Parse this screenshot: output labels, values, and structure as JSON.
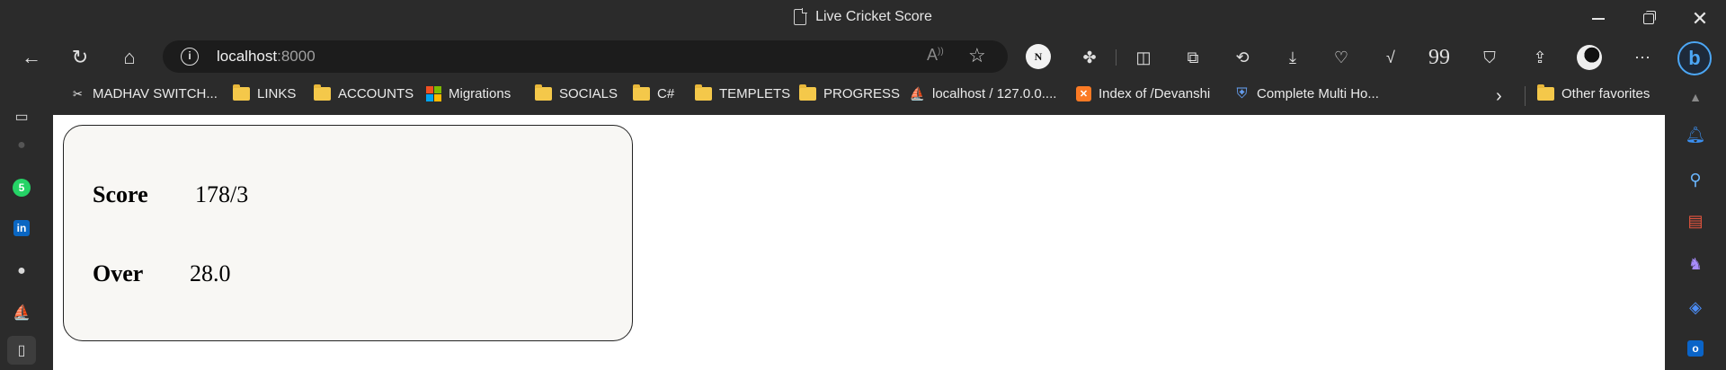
{
  "window": {
    "title": "Live Cricket Score"
  },
  "address_bar": {
    "host": "localhost",
    "port": ":8000"
  },
  "profile": {
    "extension_badge": "N"
  },
  "favorites": [
    {
      "label": "MADHAV SWITCH...",
      "icon": "scissors-icon"
    },
    {
      "label": "LINKS",
      "icon": "folder-icon"
    },
    {
      "label": "ACCOUNTS",
      "icon": "folder-icon"
    },
    {
      "label": "Migrations",
      "icon": "microsoft-logo-icon"
    },
    {
      "label": "SOCIALS",
      "icon": "folder-icon"
    },
    {
      "label": "C#",
      "icon": "folder-icon"
    },
    {
      "label": "TEMPLETS",
      "icon": "folder-icon"
    },
    {
      "label": "PROGRESS",
      "icon": "folder-icon"
    },
    {
      "label": "localhost / 127.0.0....",
      "icon": "phpmyadmin-icon"
    },
    {
      "label": "Index of /Devanshi",
      "icon": "xampp-icon"
    },
    {
      "label": "Complete Multi Ho...",
      "icon": "shield-icon"
    }
  ],
  "other_favorites": "Other favorites",
  "scoreboard": {
    "score_label": "Score",
    "score_value": "178/3",
    "over_label": "Over",
    "over_value": "28.0"
  },
  "colors": {
    "chrome_bg": "#2b2b2b",
    "address_bg": "#1c1c1c",
    "card_bg": "#f8f7f4",
    "folder": "#f4c84a",
    "accent": "#4ca7f5"
  }
}
